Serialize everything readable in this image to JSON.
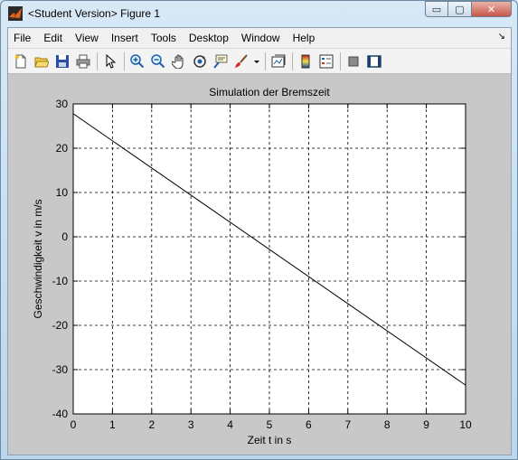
{
  "window": {
    "title": "<Student Version> Figure 1",
    "buttons": {
      "minimize": "▭",
      "maximize": "▢",
      "close": "✕"
    }
  },
  "menubar": {
    "items": [
      "File",
      "Edit",
      "View",
      "Insert",
      "Tools",
      "Desktop",
      "Window",
      "Help"
    ]
  },
  "toolbar": {
    "icons": [
      "new-file-icon",
      "open-folder-icon",
      "save-icon",
      "print-icon",
      "pointer-icon",
      "zoom-in-icon",
      "zoom-out-icon",
      "pan-hand-icon",
      "rotate-3d-icon",
      "data-cursor-icon",
      "brush-icon",
      "brush-dropdown-icon",
      "link-plot-icon",
      "colorbar-icon",
      "legend-icon",
      "hide-plot-tools-icon",
      "show-plot-tools-icon"
    ]
  },
  "chart_data": {
    "type": "line",
    "title": "Simulation der Bremszeit",
    "xlabel": "Zeit t in s",
    "ylabel": "Geschwindigkeit v in m/s",
    "xlim": [
      0,
      10
    ],
    "ylim": [
      -40,
      30
    ],
    "xticks": [
      "0",
      "1",
      "2",
      "3",
      "4",
      "5",
      "6",
      "7",
      "8",
      "9",
      "10"
    ],
    "yticks": [
      "30",
      "20",
      "10",
      "0",
      "-10",
      "-20",
      "-30",
      "-40"
    ],
    "grid": true,
    "series": [
      {
        "x": [
          0,
          10
        ],
        "y": [
          27.8,
          -33.5
        ],
        "color": "#000000"
      }
    ]
  }
}
